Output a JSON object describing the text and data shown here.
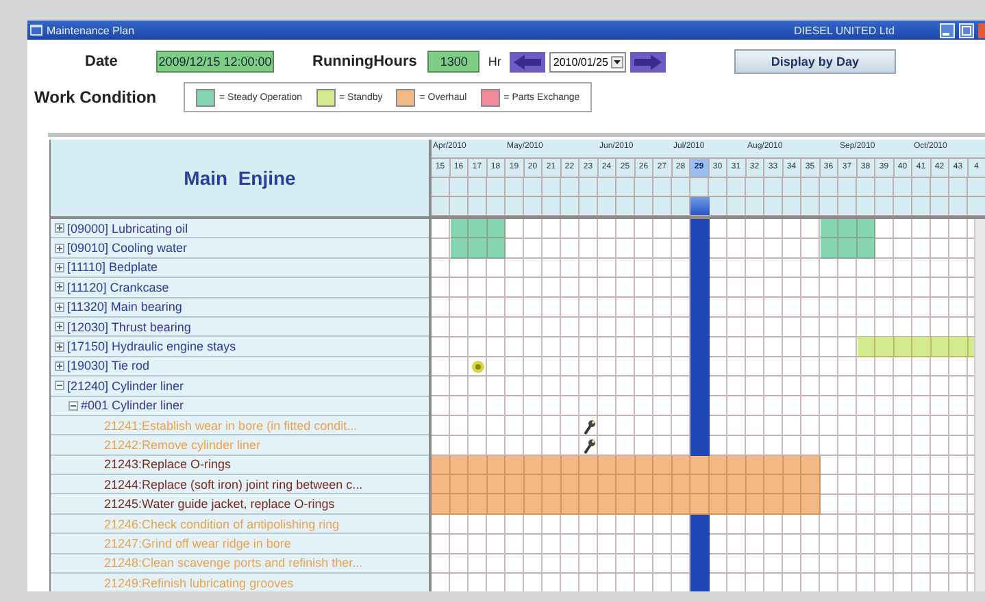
{
  "window": {
    "title": "Maintenance Plan",
    "company": "DIESEL UNITED Ltd"
  },
  "toolbar": {
    "date_label": "Date",
    "date_value": "2009/12/15 12:00:00",
    "hours_label": "RunningHours",
    "hours_value": "1300",
    "hours_unit": "Hr",
    "period_value": "2010/01/25",
    "display_button": "Display by Day"
  },
  "work_condition": {
    "label": "Work Condition",
    "items": [
      {
        "color": "#86d6b4",
        "label": "= Steady Operation"
      },
      {
        "color": "#d3ea8e",
        "label": "= Standby"
      },
      {
        "color": "#f3b883",
        "label": "= Overhaul"
      },
      {
        "color": "#f08a98",
        "label": "= Parts Exchange"
      }
    ]
  },
  "tree_header": "Main  Enjine",
  "timeline": {
    "weeks": [
      {
        "label": "15",
        "month": "Apr/2010",
        "current": false
      },
      {
        "label": "16",
        "current": false
      },
      {
        "label": "17",
        "current": false
      },
      {
        "label": "18",
        "current": false
      },
      {
        "label": "19",
        "month": "May/2010",
        "current": false
      },
      {
        "label": "20",
        "current": false
      },
      {
        "label": "21",
        "current": false
      },
      {
        "label": "22",
        "current": false
      },
      {
        "label": "23",
        "current": false
      },
      {
        "label": "24",
        "month": "Jun/2010",
        "current": false
      },
      {
        "label": "25",
        "current": false
      },
      {
        "label": "26",
        "current": false
      },
      {
        "label": "27",
        "current": false
      },
      {
        "label": "28",
        "month": "Jul/2010",
        "current": false
      },
      {
        "label": "29",
        "current": true
      },
      {
        "label": "30",
        "current": false
      },
      {
        "label": "31",
        "current": false
      },
      {
        "label": "32",
        "month": "Aug/2010",
        "current": false
      },
      {
        "label": "33",
        "current": false
      },
      {
        "label": "34",
        "current": false
      },
      {
        "label": "35",
        "current": false
      },
      {
        "label": "36",
        "current": false
      },
      {
        "label": "37",
        "month": "Sep/2010",
        "current": false
      },
      {
        "label": "38",
        "current": false
      },
      {
        "label": "39",
        "current": false
      },
      {
        "label": "40",
        "current": false
      },
      {
        "label": "41",
        "month": "Oct/2010",
        "current": false
      },
      {
        "label": "42",
        "current": false
      },
      {
        "label": "43",
        "current": false
      },
      {
        "label": "4",
        "current": false
      }
    ]
  },
  "tree": [
    {
      "label": "[09000] Lubricating oil",
      "expanded": false,
      "cells": [
        {
          "kind": "none"
        },
        {
          "kind": "steady"
        },
        {
          "kind": "steady"
        },
        {
          "kind": "steady"
        },
        {
          "kind": "none"
        },
        {
          "kind": "none"
        },
        {
          "kind": "none"
        },
        {
          "kind": "none"
        },
        {
          "kind": "none"
        },
        {
          "kind": "none"
        },
        {
          "kind": "none"
        },
        {
          "kind": "none"
        },
        {
          "kind": "none"
        },
        {
          "kind": "none"
        },
        {
          "kind": "none"
        },
        {
          "kind": "none"
        },
        {
          "kind": "none"
        },
        {
          "kind": "none"
        },
        {
          "kind": "none"
        },
        {
          "kind": "none"
        },
        {
          "kind": "none"
        },
        {
          "kind": "steady"
        },
        {
          "kind": "steady"
        },
        {
          "kind": "steady"
        },
        {
          "kind": "none"
        },
        {
          "kind": "none"
        },
        {
          "kind": "none"
        },
        {
          "kind": "none"
        },
        {
          "kind": "none"
        },
        {
          "kind": "none"
        }
      ]
    },
    {
      "label": "[09010] Cooling water",
      "expanded": false,
      "cells": [
        {
          "kind": "none"
        },
        {
          "kind": "steady"
        },
        {
          "kind": "steady"
        },
        {
          "kind": "steady"
        },
        {
          "kind": "none"
        },
        {
          "kind": "none"
        },
        {
          "kind": "none"
        },
        {
          "kind": "none"
        },
        {
          "kind": "none"
        },
        {
          "kind": "none"
        },
        {
          "kind": "none"
        },
        {
          "kind": "none"
        },
        {
          "kind": "none"
        },
        {
          "kind": "none"
        },
        {
          "kind": "none"
        },
        {
          "kind": "none"
        },
        {
          "kind": "none"
        },
        {
          "kind": "none"
        },
        {
          "kind": "none"
        },
        {
          "kind": "none"
        },
        {
          "kind": "none"
        },
        {
          "kind": "steady"
        },
        {
          "kind": "steady"
        },
        {
          "kind": "steady"
        },
        {
          "kind": "none"
        },
        {
          "kind": "none"
        },
        {
          "kind": "none"
        },
        {
          "kind": "none"
        },
        {
          "kind": "none"
        },
        {
          "kind": "none"
        }
      ]
    },
    {
      "label": "[11110] Bedplate",
      "expanded": false
    },
    {
      "label": "[11120] Crankcase",
      "expanded": false
    },
    {
      "label": "[11320] Main bearing",
      "expanded": false
    },
    {
      "label": "[12030] Thrust bearing",
      "expanded": false
    },
    {
      "label": "[17150] Hydraulic engine stays",
      "expanded": false,
      "cells": [
        {
          "kind": "none"
        },
        {
          "kind": "none"
        },
        {
          "kind": "none"
        },
        {
          "kind": "none"
        },
        {
          "kind": "none"
        },
        {
          "kind": "none"
        },
        {
          "kind": "none"
        },
        {
          "kind": "none"
        },
        {
          "kind": "none"
        },
        {
          "kind": "none"
        },
        {
          "kind": "none"
        },
        {
          "kind": "none"
        },
        {
          "kind": "none"
        },
        {
          "kind": "none"
        },
        {
          "kind": "none"
        },
        {
          "kind": "none"
        },
        {
          "kind": "none"
        },
        {
          "kind": "none"
        },
        {
          "kind": "none"
        },
        {
          "kind": "none"
        },
        {
          "kind": "none"
        },
        {
          "kind": "none"
        },
        {
          "kind": "none"
        },
        {
          "kind": "standby"
        },
        {
          "kind": "standby"
        },
        {
          "kind": "standby"
        },
        {
          "kind": "standby"
        },
        {
          "kind": "standby"
        },
        {
          "kind": "standby"
        },
        {
          "kind": "standby"
        }
      ]
    },
    {
      "label": "[19030] Tie rod",
      "expanded": false,
      "cells": [
        {
          "kind": "none"
        },
        {
          "kind": "none"
        },
        {
          "kind": "dot"
        },
        {
          "kind": "none"
        }
      ]
    },
    {
      "label": "[21240] Cylinder liner",
      "expanded": true,
      "children": [
        {
          "label": "#001 Cylinder liner",
          "expanded": true,
          "children": [
            {
              "label": "21241:Establish wear in bore (in fitted condit...",
              "emphasized": false,
              "cells": [
                {
                  "kind": "none"
                },
                {
                  "kind": "none"
                },
                {
                  "kind": "none"
                },
                {
                  "kind": "none"
                },
                {
                  "kind": "none"
                },
                {
                  "kind": "none"
                },
                {
                  "kind": "none"
                },
                {
                  "kind": "none"
                },
                {
                  "kind": "wrench"
                }
              ]
            },
            {
              "label": "21242:Remove cylinder liner",
              "emphasized": false,
              "cells": [
                {
                  "kind": "none"
                },
                {
                  "kind": "none"
                },
                {
                  "kind": "none"
                },
                {
                  "kind": "none"
                },
                {
                  "kind": "none"
                },
                {
                  "kind": "none"
                },
                {
                  "kind": "none"
                },
                {
                  "kind": "none"
                },
                {
                  "kind": "wrench"
                }
              ]
            },
            {
              "label": "21243:Replace O-rings",
              "emphasized": true,
              "cells": [
                {
                  "kind": "overhaul"
                },
                {
                  "kind": "overhaul"
                },
                {
                  "kind": "overhaul"
                },
                {
                  "kind": "overhaul"
                },
                {
                  "kind": "overhaul"
                },
                {
                  "kind": "overhaul"
                },
                {
                  "kind": "overhaul"
                },
                {
                  "kind": "overhaul"
                },
                {
                  "kind": "overhaul"
                },
                {
                  "kind": "overhaul"
                },
                {
                  "kind": "overhaul"
                },
                {
                  "kind": "overhaul"
                },
                {
                  "kind": "overhaul"
                },
                {
                  "kind": "overhaul"
                },
                {
                  "kind": "overhaul"
                },
                {
                  "kind": "overhaul"
                },
                {
                  "kind": "overhaul"
                },
                {
                  "kind": "overhaul"
                },
                {
                  "kind": "overhaul"
                },
                {
                  "kind": "overhaul"
                },
                {
                  "kind": "overhaul"
                }
              ]
            },
            {
              "label": "21244:Replace (soft iron) joint ring between c...",
              "emphasized": true,
              "cells": [
                {
                  "kind": "overhaul"
                },
                {
                  "kind": "overhaul"
                },
                {
                  "kind": "overhaul"
                },
                {
                  "kind": "overhaul"
                },
                {
                  "kind": "overhaul"
                },
                {
                  "kind": "overhaul"
                },
                {
                  "kind": "overhaul"
                },
                {
                  "kind": "overhaul"
                },
                {
                  "kind": "overhaul"
                },
                {
                  "kind": "overhaul"
                },
                {
                  "kind": "overhaul"
                },
                {
                  "kind": "overhaul"
                },
                {
                  "kind": "overhaul"
                },
                {
                  "kind": "overhaul"
                },
                {
                  "kind": "overhaul"
                },
                {
                  "kind": "overhaul"
                },
                {
                  "kind": "overhaul"
                },
                {
                  "kind": "overhaul"
                },
                {
                  "kind": "overhaul"
                },
                {
                  "kind": "overhaul"
                },
                {
                  "kind": "overhaul"
                }
              ]
            },
            {
              "label": "21245:Water guide jacket, replace O-rings",
              "emphasized": true,
              "cells": [
                {
                  "kind": "overhaul"
                },
                {
                  "kind": "overhaul"
                },
                {
                  "kind": "overhaul"
                },
                {
                  "kind": "overhaul"
                },
                {
                  "kind": "overhaul"
                },
                {
                  "kind": "overhaul"
                },
                {
                  "kind": "overhaul"
                },
                {
                  "kind": "overhaul"
                },
                {
                  "kind": "overhaul"
                },
                {
                  "kind": "overhaul"
                },
                {
                  "kind": "overhaul"
                },
                {
                  "kind": "overhaul"
                },
                {
                  "kind": "overhaul"
                },
                {
                  "kind": "overhaul"
                },
                {
                  "kind": "overhaul"
                },
                {
                  "kind": "overhaul"
                },
                {
                  "kind": "overhaul"
                },
                {
                  "kind": "overhaul"
                },
                {
                  "kind": "overhaul"
                },
                {
                  "kind": "overhaul"
                },
                {
                  "kind": "overhaul"
                }
              ]
            },
            {
              "label": "21246:Check condition of antipolishing ring",
              "emphasized": false
            },
            {
              "label": "21247:Grind off wear ridge in bore",
              "emphasized": false
            },
            {
              "label": "21248:Clean scavenge ports and refinish ther...",
              "emphasized": false
            },
            {
              "label": "21249:Refinish lubricating grooves",
              "emphasized": false
            }
          ]
        }
      ]
    }
  ]
}
